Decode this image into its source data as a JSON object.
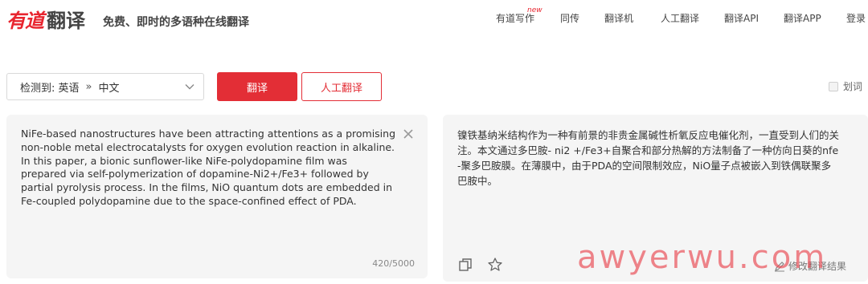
{
  "header": {
    "logo_brand": "有道",
    "logo_product": "翻译",
    "tagline": "免费、即时的多语种在线翻译",
    "nav": [
      {
        "label": "有道写作",
        "badge": "new"
      },
      {
        "label": "同传"
      },
      {
        "label": "翻译机"
      },
      {
        "label": "人工翻译"
      },
      {
        "label": "翻译API"
      },
      {
        "label": "翻译APP"
      },
      {
        "label": "登录"
      }
    ]
  },
  "controls": {
    "detect_label": "检测到: 英语",
    "separator": "»",
    "target_lang": "中文",
    "translate_button": "翻译",
    "human_button": "人工翻译",
    "huaci_label": "划词"
  },
  "source": {
    "text": "NiFe-based nanostructures have been attracting attentions as a promising\nnon-noble metal electrocatalysts for oxygen evolution reaction in alkaline.\nIn this paper, a bionic sunflower-like NiFe-polydopamine film was\nprepared via self-polymerization of dopamine-Ni2+/Fe3+ followed by\npartial pyrolysis process. In the films, NiO quantum dots are embedded in\nFe-coupled polydopamine due to the space-confined effect of PDA.",
    "char_count": "420/5000"
  },
  "result": {
    "text": "镍铁基纳米结构作为一种有前景的非贵金属碱性析氧反应电催化剂，一直受到人们的关\n注。本文通过多巴胺- ni2 +/Fe3+自聚合和部分热解的方法制备了一种仿向日葵的nfe\n-聚多巴胺膜。在薄膜中，由于PDA的空间限制效应，NiO量子点被嵌入到铁偶联聚多\n巴胺中。",
    "edit_label": "修改翻译结果"
  },
  "watermark": "awyerwu.com",
  "colors": {
    "brand_red": "#e32e36",
    "panel_bg": "#f5f5f5"
  },
  "icons": [
    "chevron-down-icon",
    "close-icon",
    "copy-icon",
    "star-icon",
    "edit-pencil-icon"
  ]
}
